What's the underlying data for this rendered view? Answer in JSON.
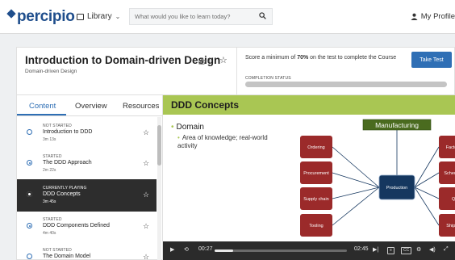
{
  "header": {
    "logo": "percipio",
    "library_label": "Library",
    "search_placeholder": "What would you like to learn today?",
    "profile_label": "My Profile"
  },
  "course": {
    "title": "Introduction to Domain-driven Design",
    "subtitle": "Domain-driven Design",
    "likes": "3"
  },
  "test": {
    "text_before": "Score a minimum of ",
    "percent": "70%",
    "text_after": " on the test to complete the Course",
    "button": "Take Test",
    "status_label": "COMPLETION STATUS",
    "progress_fraction": 0
  },
  "tabs": [
    {
      "label": "Content"
    },
    {
      "label": "Overview"
    },
    {
      "label": "Resources"
    }
  ],
  "items": [
    {
      "status": "NOT STARTED",
      "title": "Introduction to DDD",
      "duration": "3m 13s"
    },
    {
      "status": "STARTED",
      "title": "The DDD Approach",
      "duration": "2m 22s"
    },
    {
      "status": "CURRENTLY PLAYING",
      "title": "DDD Concepts",
      "duration": "3m 45s"
    },
    {
      "status": "STARTED",
      "title": "DDD Components Defined",
      "duration": "4m 40s"
    },
    {
      "status": "NOT STARTED",
      "title": "The Domain Model",
      "duration": ""
    }
  ],
  "slide": {
    "title": "DDD Concepts",
    "bullet1": "Domain",
    "bullet2": "Area of knowledge; real-world activity",
    "diagram": {
      "header": "Manufacturing",
      "center": "Production",
      "left": [
        "Ordering",
        "Procurement",
        "Supply chain",
        "Tooling"
      ],
      "right": [
        "Factories",
        "Scheduling",
        "QA",
        "Shipping"
      ],
      "colors": {
        "header": "#4a6b1f",
        "center": "#15375f",
        "node": "#9b2a2a"
      }
    }
  },
  "player": {
    "elapsed": "00:27",
    "remaining": "02:45",
    "progress_fraction": 0.14,
    "cc_label": "CC"
  }
}
